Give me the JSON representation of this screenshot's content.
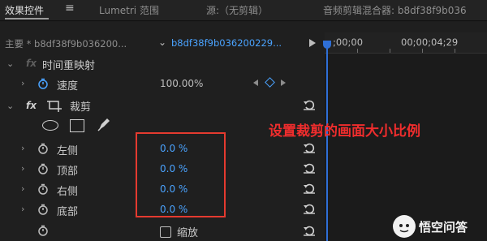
{
  "tabs": [
    {
      "label": "效果控件"
    },
    {
      "label": "Lumetri 范围"
    },
    {
      "label": "源:（无剪辑）"
    },
    {
      "label": "音频剪辑混合器: b8df38f9b036"
    }
  ],
  "panel_menu_icon": "hamburger-icon",
  "header": {
    "master_label": "主要 * b8df38f9b036200...",
    "clip_label": "b8df38f9b036200229...",
    "timecode_start": ";00;00",
    "timecode_end": "00;00;04;29"
  },
  "properties": {
    "time_remap": {
      "label": "时间重映射"
    },
    "speed": {
      "label": "速度",
      "value": "100.00%"
    },
    "crop": {
      "label": "裁剪"
    },
    "left": {
      "label": "左侧",
      "value": "0.0 %"
    },
    "top": {
      "label": "顶部",
      "value": "0.0 %"
    },
    "right": {
      "label": "右侧",
      "value": "0.0 %"
    },
    "bottom": {
      "label": "底部",
      "value": "0.0 %"
    },
    "zoom": {
      "label": "缩放",
      "checked": false
    }
  },
  "fx_label": "fx",
  "annotation": "设置裁剪的画面大小比例",
  "watermark": {
    "text": "悟空问答"
  },
  "colors": {
    "accent_blue": "#4aa3ff",
    "playhead": "#2f6fd6",
    "highlight": "#e43a2f"
  }
}
